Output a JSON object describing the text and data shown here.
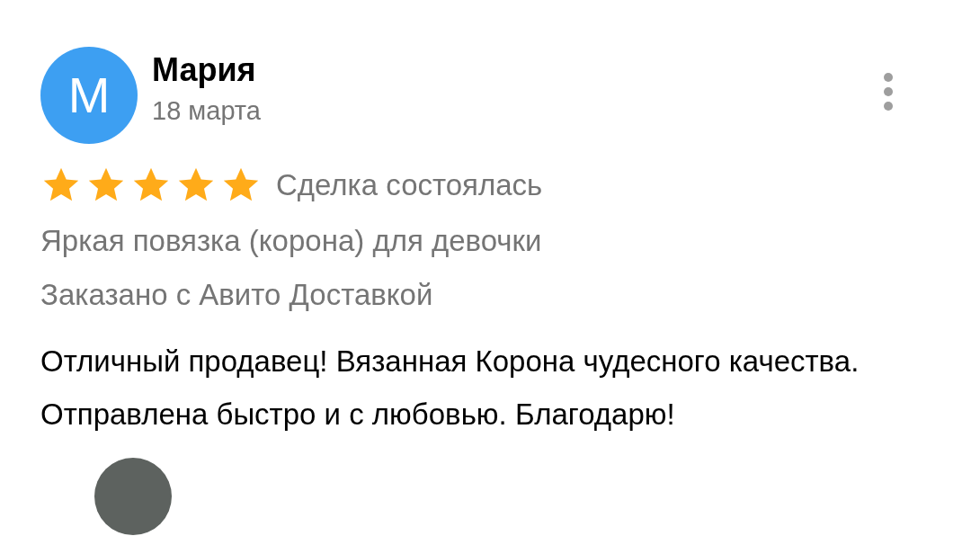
{
  "review": {
    "avatar_letter": "М",
    "name": "Мария",
    "date": "18 марта",
    "stars": 5,
    "deal_status": "Сделка состоялась",
    "item": "Яркая повязка (корона) для девочки",
    "delivery": "Заказано с Авито Доставкой",
    "text": "Отличный продавец! Вязанная Корона чудесного качества. Отправлена быстро и с любовью. Благодарю!"
  }
}
